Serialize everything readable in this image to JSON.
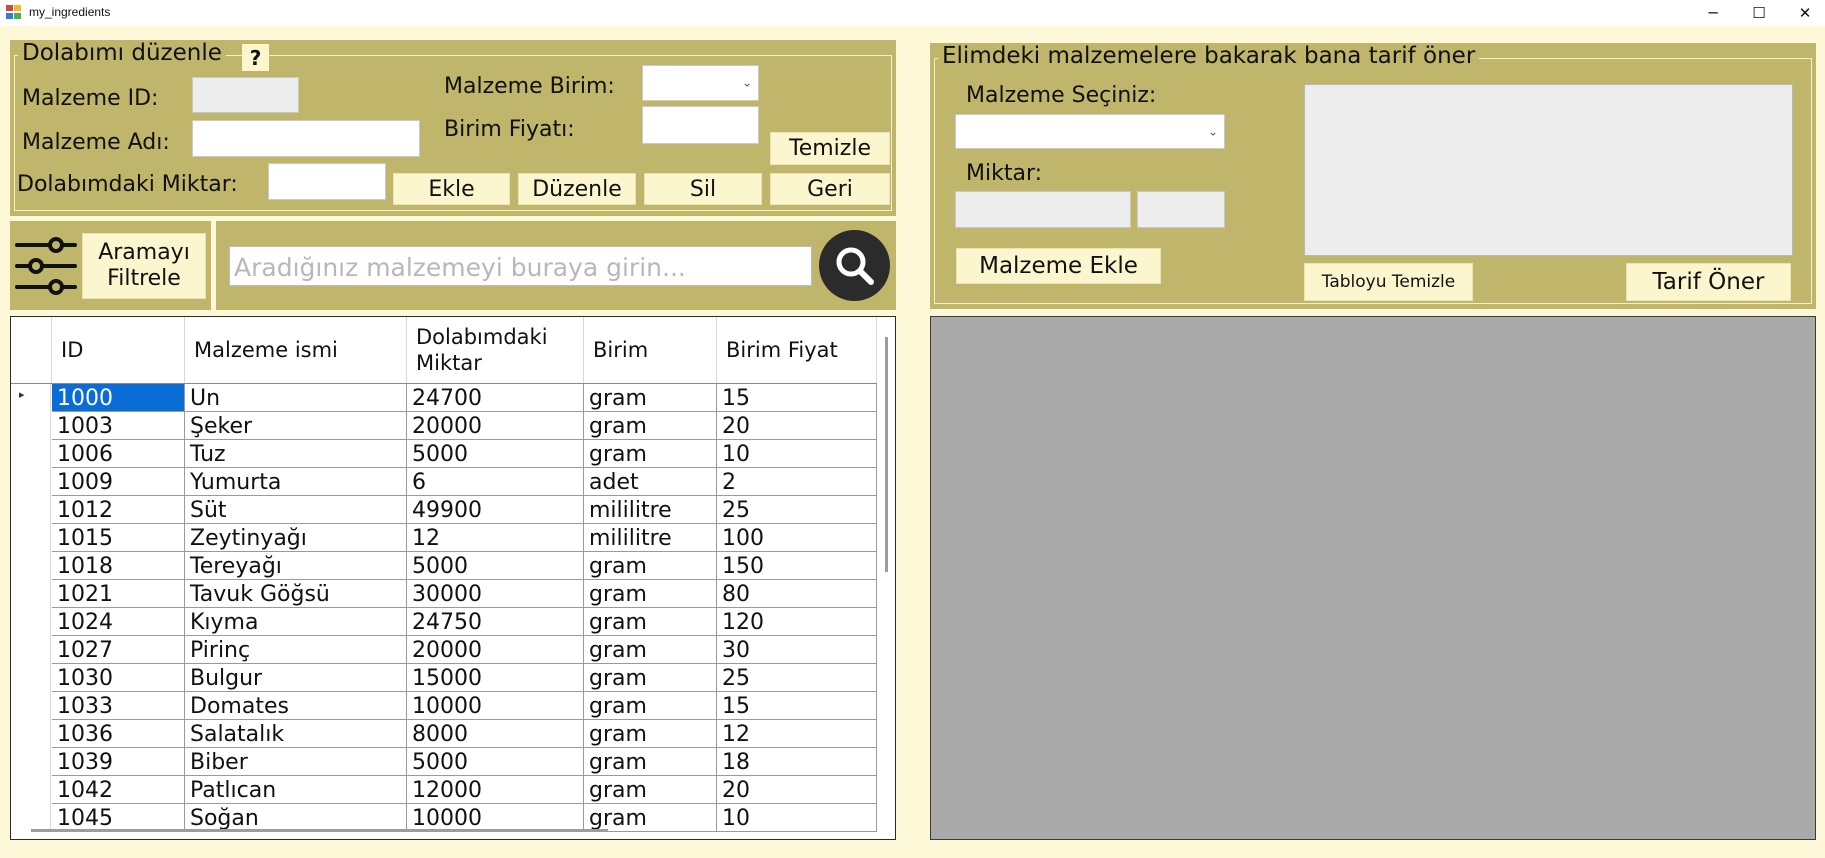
{
  "window": {
    "title": "my_ingredients",
    "minimize": "─",
    "maximize": "☐",
    "close": "✕"
  },
  "edit_group": {
    "legend": "Dolabımı düzenle",
    "help": "?",
    "id_label": "Malzeme ID:",
    "id_value": "",
    "name_label": "Malzeme Adı:",
    "name_value": "",
    "qty_label": "Dolabımdaki Miktar:",
    "qty_value": "",
    "unit_label": "Malzeme Birim:",
    "unit_value": "",
    "price_label": "Birim Fiyatı:",
    "price_value": "",
    "clear_button": "Temizle",
    "add_button": "Ekle",
    "edit_button": "Düzenle",
    "delete_button": "Sil",
    "back_button": "Geri"
  },
  "filter": {
    "button_line1": "Aramayı",
    "button_line2": "Filtrele"
  },
  "search": {
    "placeholder": "Aradığınız malzemeyi buraya girin..."
  },
  "grid": {
    "columns": [
      "ID",
      "Malzeme ismi",
      "Dolabımdaki Miktar",
      "Birim",
      "Birim Fiyat"
    ],
    "rows": [
      [
        "1000",
        "Un",
        "24700",
        "gram",
        "15"
      ],
      [
        "1003",
        "Şeker",
        "20000",
        "gram",
        "20"
      ],
      [
        "1006",
        "Tuz",
        "5000",
        "gram",
        "10"
      ],
      [
        "1009",
        "Yumurta",
        "6",
        "adet",
        "2"
      ],
      [
        "1012",
        "Süt",
        "49900",
        "mililitre",
        "25"
      ],
      [
        "1015",
        "Zeytinyağı",
        "12",
        "mililitre",
        "100"
      ],
      [
        "1018",
        "Tereyağı",
        "5000",
        "gram",
        "150"
      ],
      [
        "1021",
        "Tavuk Göğsü",
        "30000",
        "gram",
        "80"
      ],
      [
        "1024",
        "Kıyma",
        "24750",
        "gram",
        "120"
      ],
      [
        "1027",
        "Pirinç",
        "20000",
        "gram",
        "30"
      ],
      [
        "1030",
        "Bulgur",
        "15000",
        "gram",
        "25"
      ],
      [
        "1033",
        "Domates",
        "10000",
        "gram",
        "15"
      ],
      [
        "1036",
        "Salatalık",
        "8000",
        "gram",
        "12"
      ],
      [
        "1039",
        "Biber",
        "5000",
        "gram",
        "18"
      ],
      [
        "1042",
        "Patlıcan",
        "12000",
        "gram",
        "20"
      ],
      [
        "1045",
        "Soğan",
        "10000",
        "gram",
        "10"
      ]
    ],
    "selected_row": 0,
    "row_indicator": "▸"
  },
  "recipe_group": {
    "legend": "Elimdeki malzemelere bakarak bana tarif öner",
    "select_label": "Malzeme Seçiniz:",
    "select_value": "",
    "amount_label": "Miktar:",
    "amount_value": "",
    "amount_unit": "",
    "add_ingredient_button": "Malzeme Ekle",
    "clear_table_button": "Tabloyu Temizle",
    "suggest_button": "Tarif Öner",
    "list_text": ""
  },
  "colors": {
    "panel": "#bfb56b",
    "background": "#fdf8d8",
    "button": "#fcf6cf",
    "selection": "#0a6cd6",
    "results_area": "#aaaaaa"
  },
  "icons": [
    "app-icon",
    "help-icon",
    "filter-sliders-icon",
    "search-icon",
    "chevron-down-icon"
  ]
}
